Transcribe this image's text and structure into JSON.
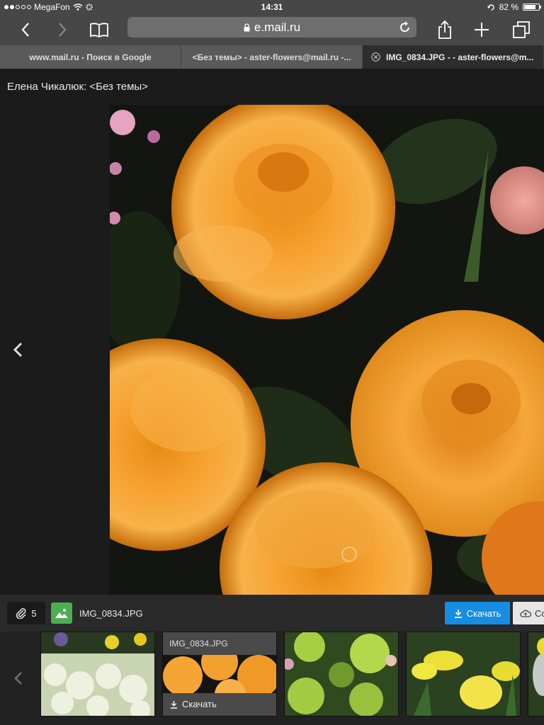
{
  "status_bar": {
    "carrier": "MegaFon",
    "time": "14:31",
    "battery": "82 %",
    "battery_level": 0.82,
    "signal_dots_filled": 2,
    "signal_dots_total": 5
  },
  "toolbar": {
    "url": "e.mail.ru",
    "icons": [
      "back-icon",
      "forward-icon",
      "bookmarks-icon",
      "lock-icon",
      "reload-icon",
      "share-icon",
      "new-tab-icon",
      "tabs-icon"
    ]
  },
  "tabs": [
    {
      "label": "www.mail.ru - Поиск в Google",
      "active": false
    },
    {
      "label": "<Без темы> - aster-flowers@mail.ru -...",
      "active": false
    },
    {
      "label": "IMG_0834.JPG - - aster-flowers@m...",
      "active": true
    }
  ],
  "page": {
    "sender_subject": "Елена Чикалюк: <Без темы>"
  },
  "attachments": {
    "count": "5",
    "file_name": "IMG_0834.JPG",
    "download_label": "Скачать",
    "cloud_label": "Со"
  },
  "thumbnails": [
    {
      "title": "",
      "kind": "lilac-narcissus"
    },
    {
      "title": "IMG_0834.JPG",
      "download_label": "Скачать",
      "kind": "orange-roses",
      "active": true
    },
    {
      "title": "",
      "kind": "green-viburnum"
    },
    {
      "title": "",
      "kind": "yellow-daffodils"
    }
  ],
  "colors": {
    "chrome": "#474747",
    "accent": "#168de2",
    "file_icon": "#4caf50"
  }
}
